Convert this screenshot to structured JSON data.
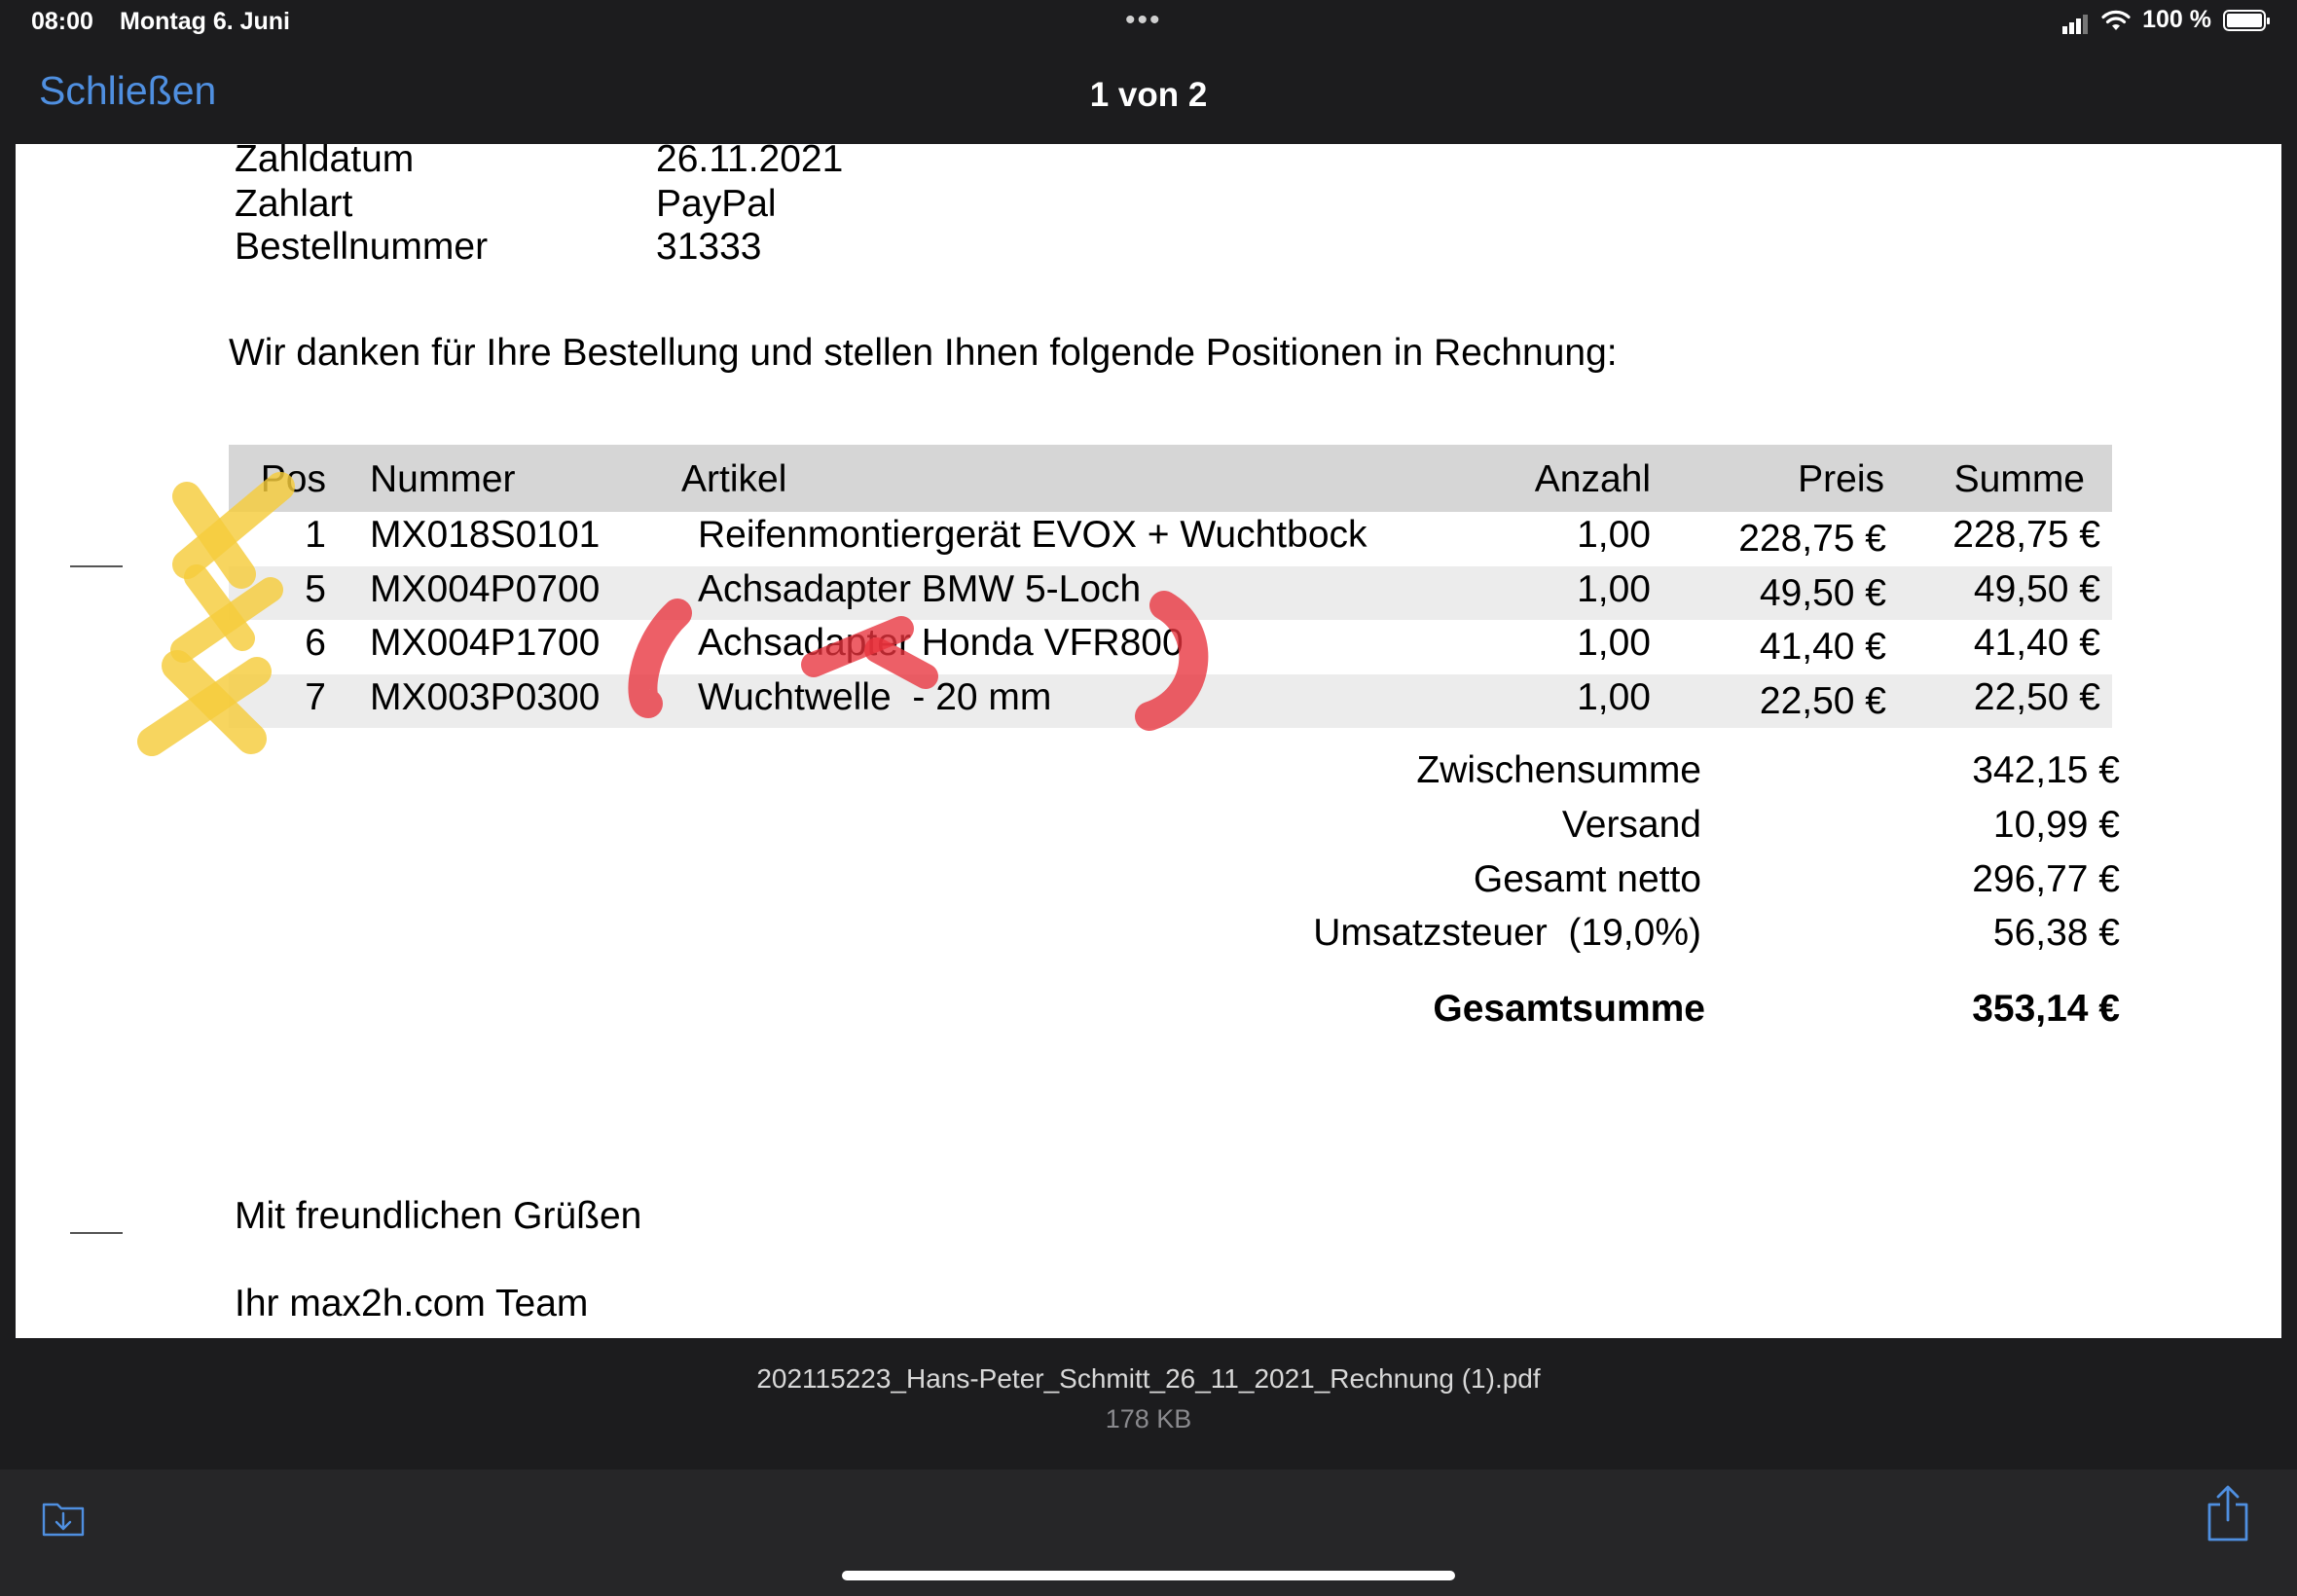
{
  "status_bar": {
    "time": "08:00",
    "date": "Montag 6. Juni",
    "battery": "100 %"
  },
  "nav": {
    "close_label": "Schließen",
    "page_indicator": "1 von 2"
  },
  "document": {
    "meta": [
      {
        "label": "Zahldatum",
        "value": "26.11.2021"
      },
      {
        "label": "Zahlart",
        "value": "PayPal"
      },
      {
        "label": "Bestellnummer",
        "value": "31333"
      }
    ],
    "intro": "Wir danken für Ihre Bestellung und stellen Ihnen folgende Positionen in Rechnung:",
    "table": {
      "headers": {
        "pos": "Pos",
        "nummer": "Nummer",
        "artikel": "Artikel",
        "anzahl": "Anzahl",
        "preis": "Preis",
        "summe": "Summe"
      },
      "rows": [
        {
          "pos": "1",
          "nummer": "MX018S0101",
          "artikel": "Reifenmontiergerät EVOX + Wuchtbock",
          "anzahl": "1,00",
          "preis": "228,75 €",
          "summe": "228,75 €"
        },
        {
          "pos": "5",
          "nummer": "MX004P0700",
          "artikel": "Achsadapter BMW 5-Loch",
          "anzahl": "1,00",
          "preis": "49,50 €",
          "summe": "49,50 €"
        },
        {
          "pos": "6",
          "nummer": "MX004P1700",
          "artikel": "Achsadapter Honda VFR800",
          "anzahl": "1,00",
          "preis": "41,40 €",
          "summe": "41,40 €"
        },
        {
          "pos": "7",
          "nummer": "MX003P0300",
          "artikel": "Wuchtwelle  - 20 mm",
          "anzahl": "1,00",
          "preis": "22,50 €",
          "summe": "22,50 €"
        }
      ]
    },
    "totals": [
      {
        "label": "Zwischensumme",
        "value": "342,15 €"
      },
      {
        "label": "Versand",
        "value": "10,99 €"
      },
      {
        "label": "Gesamt netto",
        "value": "296,77 €"
      },
      {
        "label": "Umsatzsteuer  (19,0%)",
        "value": "56,38 €"
      }
    ],
    "grand_total": {
      "label": "Gesamtsumme",
      "value": "353,14 €"
    },
    "closing": "Mit freundlichen Grüßen",
    "signature": "Ihr max2h.com Team"
  },
  "file": {
    "name": "202115223_Hans-Peter_Schmitt_26_11_2021_Rechnung (1).pdf",
    "size": "178 KB"
  },
  "colors": {
    "background": "#1c1c1e",
    "accent": "#4f8fe0",
    "highlight_yellow": "#f5cc3c",
    "highlight_red": "#e8323c"
  },
  "icons": {
    "save": "save-to-files-icon",
    "share": "share-icon"
  }
}
